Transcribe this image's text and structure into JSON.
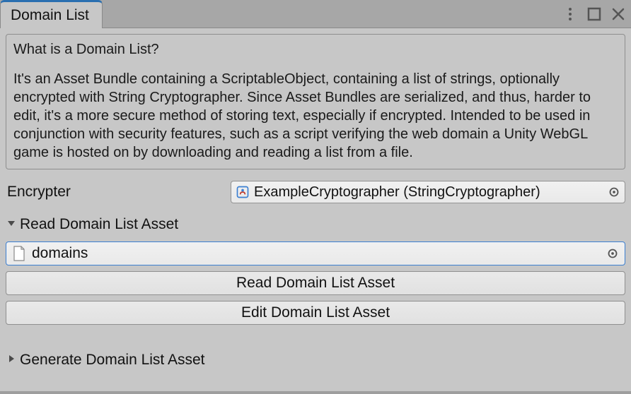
{
  "tab": {
    "title": "Domain List"
  },
  "helpbox": {
    "heading": "What is a Domain List?",
    "body": "It's an Asset Bundle containing a ScriptableObject, containing a list of strings, optionally encrypted with String Cryptographer. Since Asset Bundles are serialized, and thus, harder to edit, it's a more secure method of storing text, especially if encrypted. Intended to be used in conjunction with security features, such as a script verifying the web domain a Unity WebGL game is hosted on by downloading and reading a list from a file."
  },
  "fields": {
    "encrypter": {
      "label": "Encrypter",
      "value": "ExampleCryptographer (StringCryptographer)"
    }
  },
  "sections": {
    "read": {
      "title": "Read Domain List Asset",
      "expanded": true,
      "asset_value": "domains",
      "btn_read": "Read Domain List Asset",
      "btn_edit": "Edit Domain List Asset"
    },
    "generate": {
      "title": "Generate Domain List Asset",
      "expanded": false
    }
  },
  "icons": {
    "kebab": "kebab-icon",
    "maximize": "maximize-icon",
    "close": "close-icon",
    "scriptable_object": "scriptable-object-icon",
    "object_picker": "object-picker-icon",
    "file": "file-icon",
    "foldout_open": "foldout-open-icon",
    "foldout_closed": "foldout-closed-icon"
  }
}
